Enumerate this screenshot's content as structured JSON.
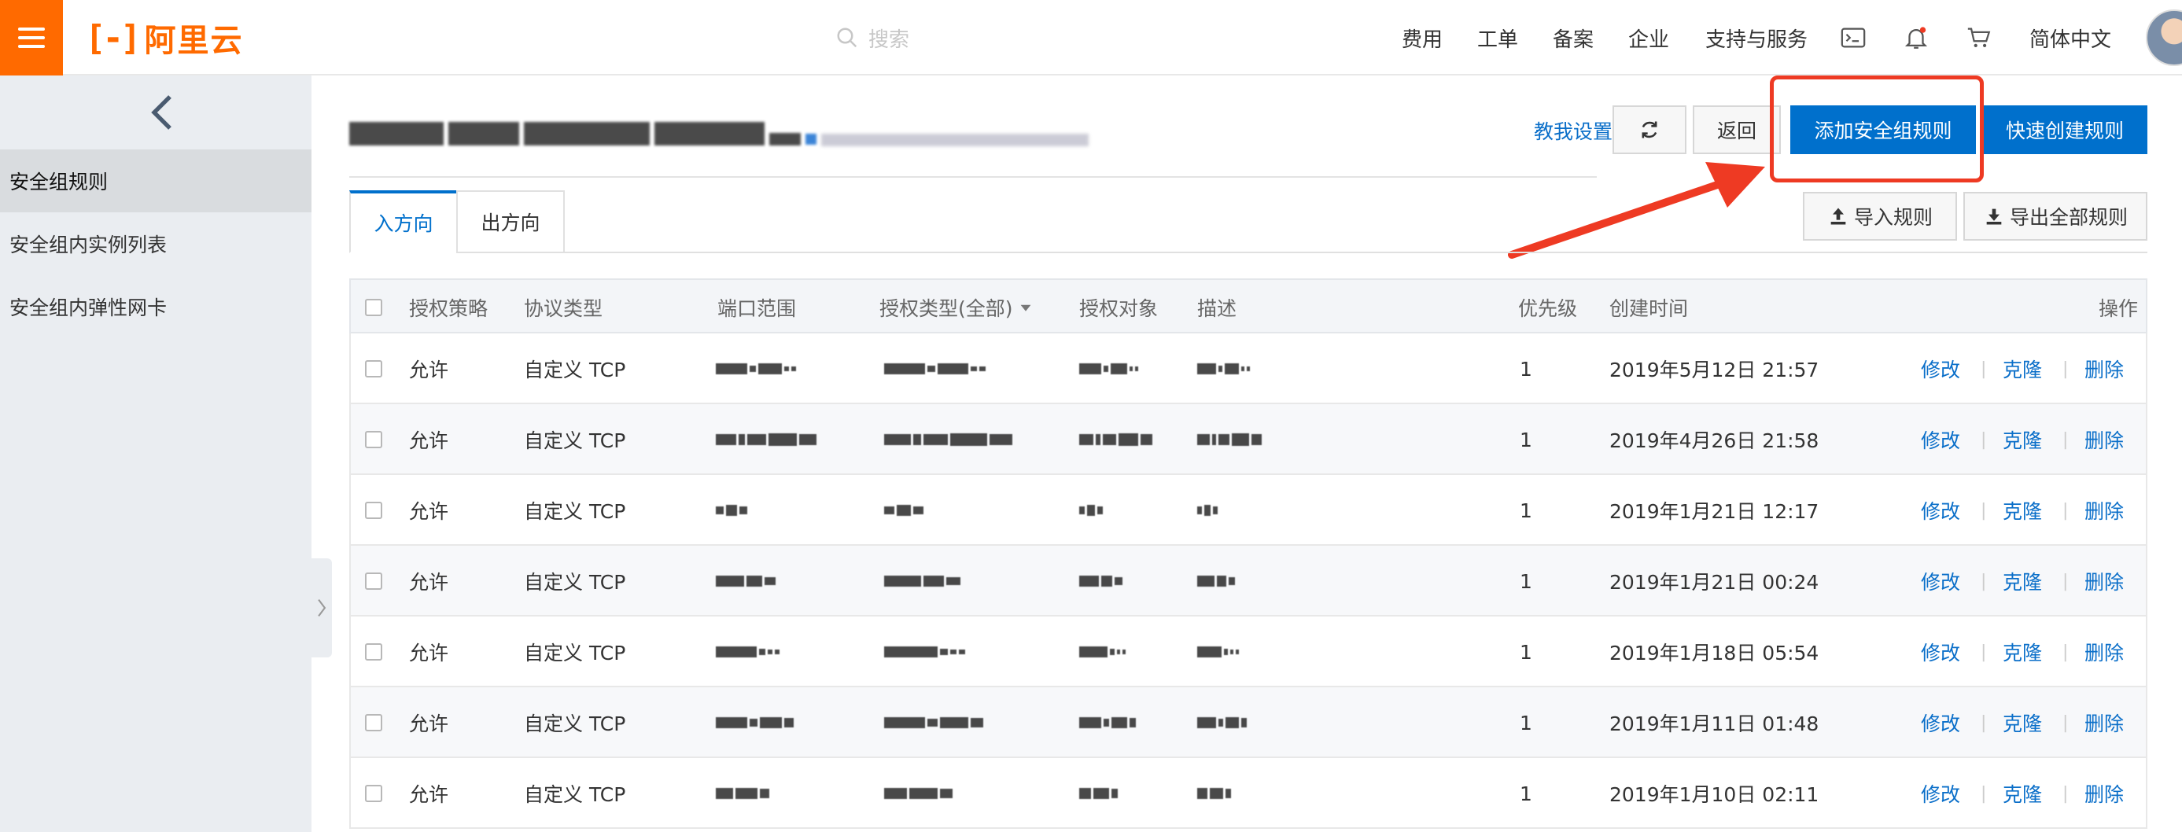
{
  "header": {
    "logo_mark": "[-]",
    "logo_text": "阿里云",
    "search_placeholder": "搜索",
    "nav": [
      "费用",
      "工单",
      "备案",
      "企业",
      "支持与服务"
    ],
    "language": "简体中文",
    "icons": [
      "terminal-icon",
      "bell-icon",
      "cart-icon"
    ],
    "accent_color": "#ff6a00"
  },
  "sidebar": {
    "items": [
      {
        "label": "安全组规则",
        "active": true
      },
      {
        "label": "安全组内实例列表",
        "active": false
      },
      {
        "label": "安全组内弹性网卡",
        "active": false
      }
    ]
  },
  "toolbar": {
    "help_link": "教我设置",
    "back_label": "返回",
    "add_rule_label": "添加安全组规则",
    "quick_create_label": "快速创建规则",
    "import_label": "导入规则",
    "export_label": "导出全部规则",
    "primary_color": "#0070cc",
    "highlight_color": "#ee3a23"
  },
  "tabs": [
    {
      "label": "入方向",
      "active": true
    },
    {
      "label": "出方向",
      "active": false
    }
  ],
  "table": {
    "columns": [
      "授权策略",
      "协议类型",
      "端口范围",
      "授权类型(全部)",
      "授权对象",
      "描述",
      "优先级",
      "创建时间",
      "操作"
    ],
    "rows": [
      {
        "policy": "允许",
        "protocol": "自定义 TCP",
        "priority": "1",
        "created": "2019年5月12日 21:57"
      },
      {
        "policy": "允许",
        "protocol": "自定义 TCP",
        "priority": "1",
        "created": "2019年4月26日 21:58"
      },
      {
        "policy": "允许",
        "protocol": "自定义 TCP",
        "priority": "1",
        "created": "2019年1月21日 12:17"
      },
      {
        "policy": "允许",
        "protocol": "自定义 TCP",
        "priority": "1",
        "created": "2019年1月21日 00:24"
      },
      {
        "policy": "允许",
        "protocol": "自定义 TCP",
        "priority": "1",
        "created": "2019年1月18日 05:54"
      },
      {
        "policy": "允许",
        "protocol": "自定义 TCP",
        "priority": "1",
        "created": "2019年1月11日 01:48"
      },
      {
        "policy": "允许",
        "protocol": "自定义 TCP",
        "priority": "1",
        "created": "2019年1月10日 02:11"
      }
    ],
    "actions": {
      "edit": "修改",
      "clone": "克隆",
      "delete": "删除",
      "separator": "|"
    }
  }
}
